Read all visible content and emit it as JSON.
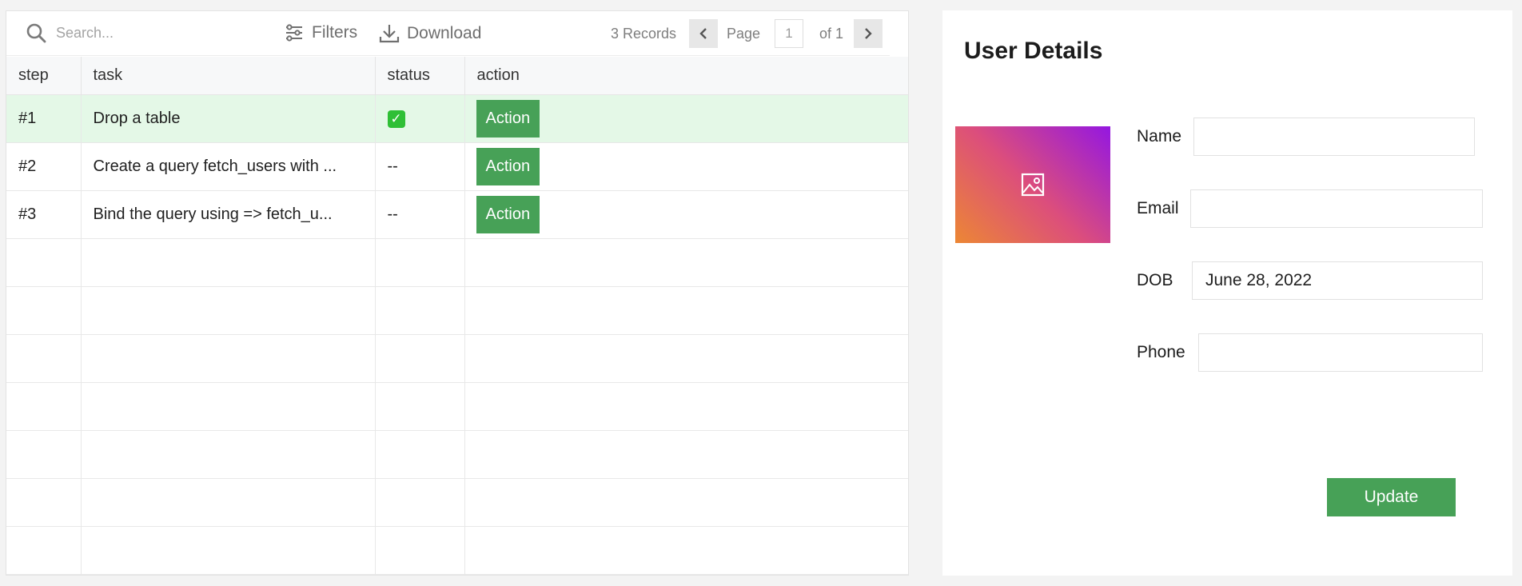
{
  "table": {
    "search_placeholder": "Search...",
    "filters_label": "Filters",
    "download_label": "Download",
    "records_label": "3 Records",
    "page_label": "Page",
    "page_number": "1",
    "page_of": "of 1",
    "columns": [
      "step",
      "task",
      "status",
      "action"
    ],
    "rows": [
      {
        "step": "#1",
        "task": "Drop a table",
        "status": "✓",
        "action": "Action"
      },
      {
        "step": "#2",
        "task": "Create a query fetch_users with ...",
        "status": "--",
        "action": "Action"
      },
      {
        "step": "#3",
        "task": "Bind the query using => fetch_u...",
        "status": "--",
        "action": "Action"
      }
    ],
    "colors": {
      "selected_row": "#e4f8e7",
      "action_button": "#47a157",
      "check": "#2fbf36"
    }
  },
  "form": {
    "title": "User Details",
    "fields": {
      "name": {
        "label": "Name",
        "value": ""
      },
      "email": {
        "label": "Email",
        "value": ""
      },
      "dob": {
        "label": "DOB",
        "value": "June 28, 2022"
      },
      "phone": {
        "label": "Phone",
        "value": ""
      }
    },
    "update_label": "Update",
    "avatar_icon": "image-placeholder-icon"
  }
}
